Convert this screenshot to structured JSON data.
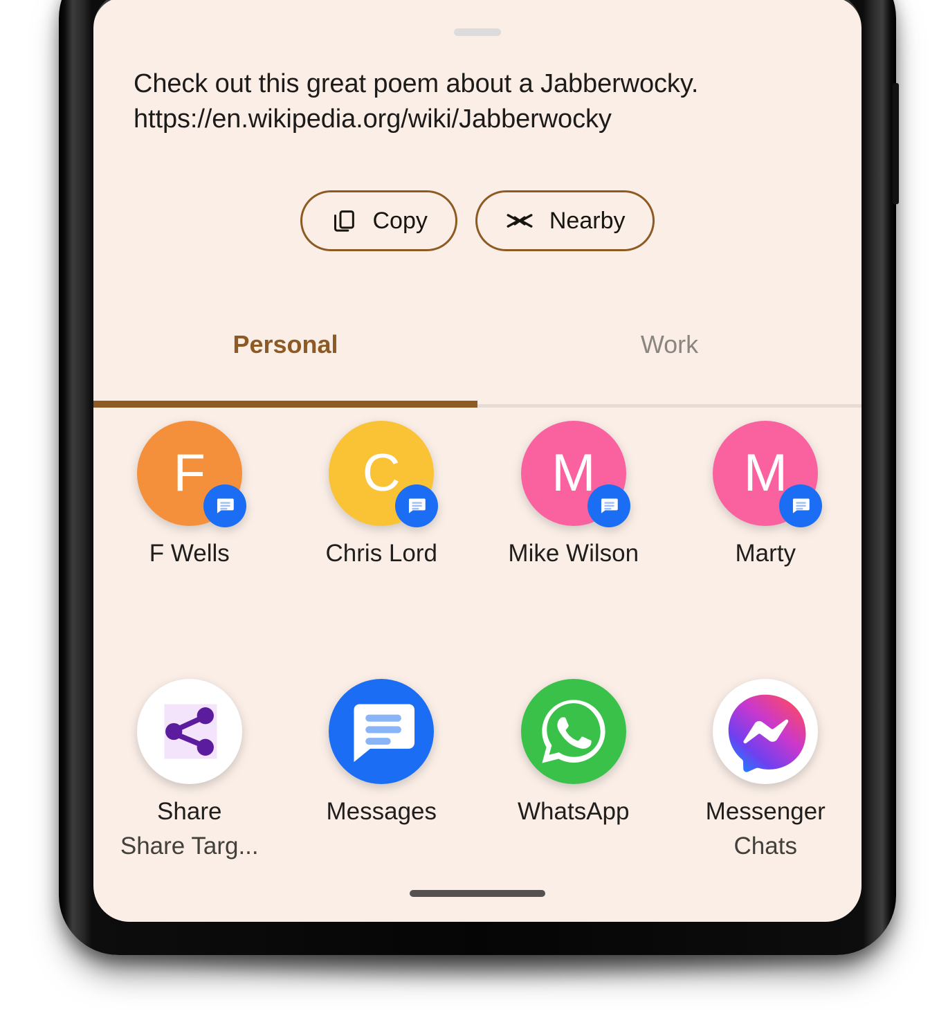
{
  "share_sheet": {
    "preview_text": "Check out this great poem about a Jabberwocky.\nhttps://en.wikipedia.org/wiki/Jabberwocky",
    "actions": [
      {
        "label": "Copy",
        "icon": "copy-icon"
      },
      {
        "label": "Nearby",
        "icon": "nearby-share-icon"
      }
    ],
    "tabs": [
      {
        "label": "Personal",
        "active": true
      },
      {
        "label": "Work",
        "active": false
      }
    ],
    "contacts": [
      {
        "name": "F Wells",
        "initial": "F",
        "color": "#f4903c",
        "badge": "messages-icon"
      },
      {
        "name": "Chris Lord",
        "initial": "C",
        "color": "#fac235",
        "badge": "messages-icon"
      },
      {
        "name": "Mike Wilson",
        "initial": "M",
        "color": "#f9629f",
        "badge": "messages-icon"
      },
      {
        "name": "Marty",
        "initial": "M",
        "color": "#f9629f",
        "badge": "messages-icon"
      }
    ],
    "apps": [
      {
        "label": "Share",
        "sublabel": "Share Targ...",
        "icon": "share-target-icon"
      },
      {
        "label": "Messages",
        "sublabel": "",
        "icon": "google-messages-icon"
      },
      {
        "label": "WhatsApp",
        "sublabel": "",
        "icon": "whatsapp-icon"
      },
      {
        "label": "Messenger",
        "sublabel": "Chats",
        "icon": "messenger-icon"
      }
    ],
    "colors": {
      "sheet_background": "#faeee7",
      "accent": "#8d5a24",
      "inactive_tab": "#8b8580",
      "badge_blue": "#1b6ef3",
      "whatsapp_green": "#3ac14a"
    }
  }
}
